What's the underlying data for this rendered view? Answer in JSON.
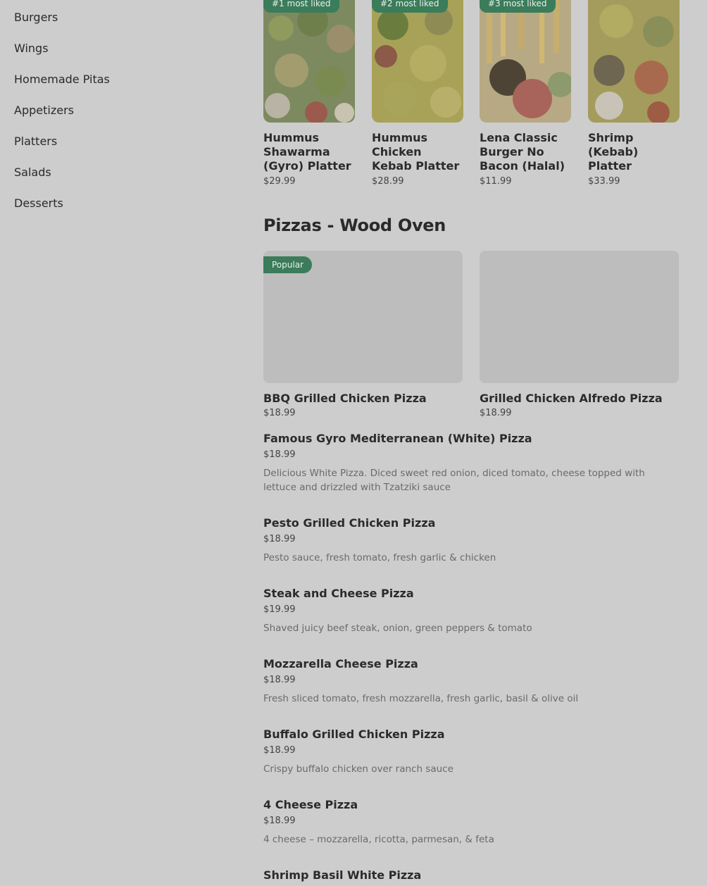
{
  "sidebar": {
    "categories": [
      "Burgers",
      "Wings",
      "Homemade Pitas",
      "Appetizers",
      "Platters",
      "Salads",
      "Desserts"
    ]
  },
  "popular_items": [
    {
      "badge": "#1 most liked",
      "name": "Hummus Shawarma (Gyro) Platter",
      "price": "$29.99"
    },
    {
      "badge": "#2 most liked",
      "name": "Hummus Chicken Kebab Platter",
      "price": "$28.99"
    },
    {
      "badge": "#3 most liked",
      "name": "Lena Classic Burger No Bacon (Halal)",
      "price": "$11.99"
    },
    {
      "badge": "",
      "name": "Shrimp (Kebab) Platter",
      "price": "$33.99"
    }
  ],
  "section": {
    "title": "Pizzas - Wood Oven",
    "featured": [
      {
        "badge": "Popular",
        "name": "BBQ Grilled Chicken Pizza",
        "price": "$18.99"
      },
      {
        "badge": "",
        "name": "Grilled Chicken Alfredo Pizza",
        "price": "$18.99"
      }
    ],
    "items": [
      {
        "name": "Famous Gyro Mediterranean (White) Pizza",
        "price": "$18.99",
        "desc": "Delicious White Pizza. Diced sweet red onion, diced tomato, cheese topped with lettuce and drizzled with Tzatziki sauce"
      },
      {
        "name": "Pesto Grilled Chicken Pizza",
        "price": "$18.99",
        "desc": "Pesto sauce, fresh tomato, fresh garlic & chicken"
      },
      {
        "name": "Steak and Cheese Pizza",
        "price": "$19.99",
        "desc": "Shaved juicy beef steak, onion, green peppers & tomato"
      },
      {
        "name": "Mozzarella Cheese Pizza",
        "price": "$18.99",
        "desc": "Fresh sliced tomato, fresh mozzarella, fresh garlic, basil & olive oil"
      },
      {
        "name": "Buffalo Grilled Chicken Pizza",
        "price": "$18.99",
        "desc": "Crispy buffalo chicken over ranch sauce"
      },
      {
        "name": "4 Cheese Pizza",
        "price": "$18.99",
        "desc": "4 cheese – mozzarella, ricotta, parmesan, & feta"
      },
      {
        "name": "Shrimp Basil White Pizza",
        "price": "",
        "desc": ""
      }
    ]
  },
  "colors": {
    "overlay_bg": "#cdcdcd",
    "badge_green": "#3b7c5a"
  }
}
